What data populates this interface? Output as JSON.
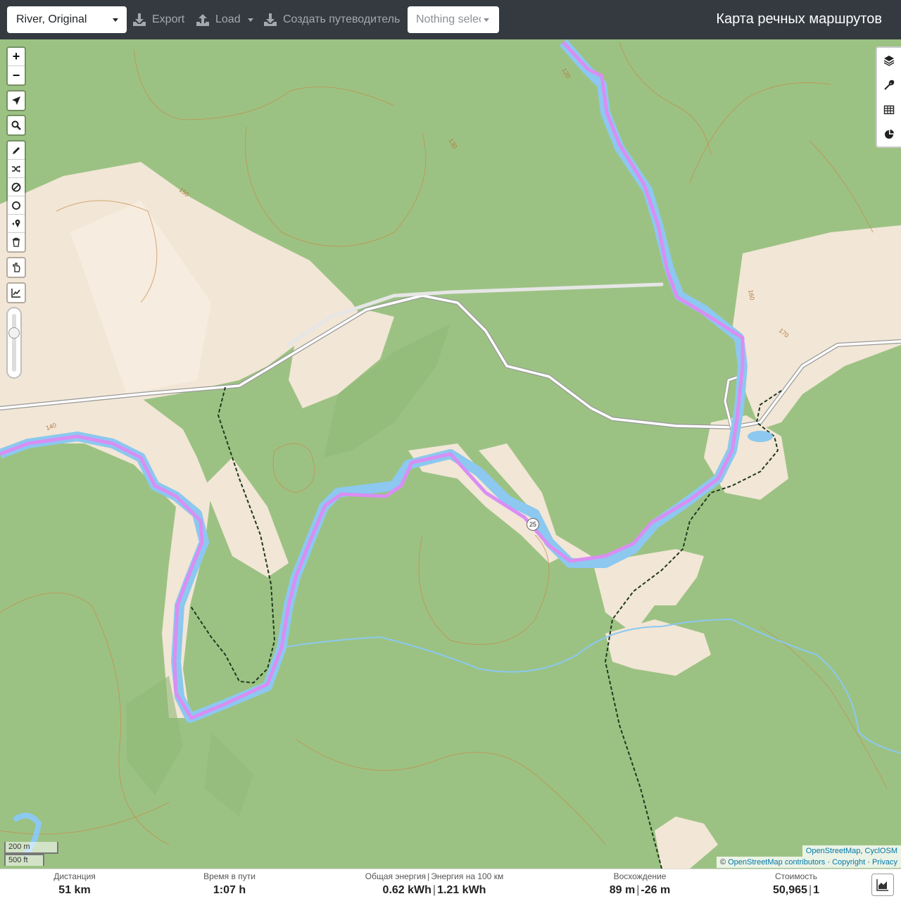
{
  "header": {
    "profile_select": "River, Original",
    "export_label": "Export",
    "load_label": "Load",
    "guide_label": "Создать путеводитель",
    "nothing_selected": "Nothing selected",
    "title": "Карта речных маршрутов"
  },
  "map": {
    "zoom_in": "+",
    "zoom_out": "−",
    "route_marker": "25",
    "contour_labels": [
      "120",
      "140",
      "130",
      "150",
      "160",
      "170"
    ],
    "scale_metric": "200 m",
    "scale_imperial": "500 ft",
    "attribution_tiles_1": "OpenStreetMap",
    "attribution_tiles_2": "CyclOSM",
    "attribution_copy": "©",
    "attribution_osm": "OpenStreetMap contributors",
    "attribution_copyright": "Copyright",
    "attribution_privacy": "Privacy"
  },
  "footer": {
    "distance": {
      "label": "Дистанция",
      "value": "51",
      "unit": "km"
    },
    "time": {
      "label": "Время в пути",
      "value": "1:07",
      "unit": "h"
    },
    "energy": {
      "label": "Общая энергия",
      "label2": "Энергия на 100 км",
      "value": "0.62",
      "unit": "kWh",
      "value2": "1.21",
      "unit2": "kWh"
    },
    "ascent": {
      "label": "Восхождение",
      "value": "89",
      "unit": "m",
      "value2": "-26",
      "unit2": "m"
    },
    "cost": {
      "label": "Стоимость",
      "value": "50,965",
      "value2": "1"
    }
  },
  "colors": {
    "header_bg": "#343a40",
    "forest": "#9cc283",
    "clearing": "#f2e6d6",
    "river": "#8cc8ef",
    "route": "#d98ef3",
    "road": "#ffffff"
  }
}
